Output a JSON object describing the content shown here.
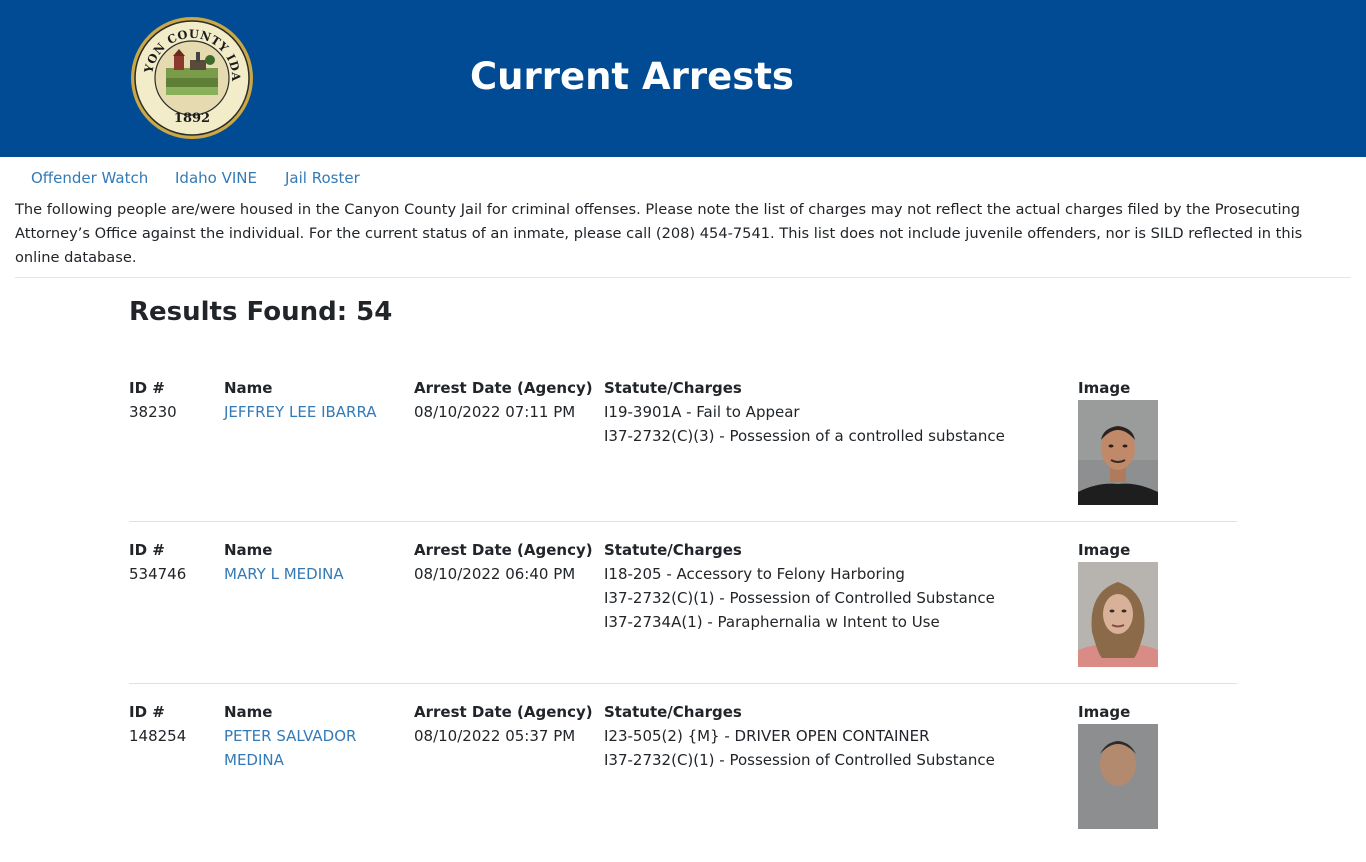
{
  "header": {
    "title": "Current Arrests",
    "seal_text": "CANYON COUNTY IDAHO",
    "seal_year": "1892",
    "background": "#004b93"
  },
  "nav": {
    "links": [
      {
        "label": "Offender Watch"
      },
      {
        "label": "Idaho VINE"
      },
      {
        "label": "Jail Roster"
      }
    ]
  },
  "intro": "The following people are/were housed in the Canyon County Jail for criminal offenses. Please note the list of charges may not reflect the actual charges filed by the Prosecuting Attorney’s Office against the individual. For the current status of an inmate, please call (208) 454-7541. This list does not include juvenile offenders, nor is SILD reflected in this online database.",
  "results": {
    "heading": "Results Found: 54"
  },
  "columns": {
    "id": "ID #",
    "name": "Name",
    "arrest_date": "Arrest Date (Agency)",
    "charges": "Statute/Charges",
    "image": "Image"
  },
  "records": [
    {
      "id": "38230",
      "name_line1": "JEFFREY LEE IBARRA",
      "name_line2": "",
      "arrest_date": "08/10/2022 07:11 PM",
      "charges": [
        "I19-3901A - Fail to Appear",
        "I37-2732(C)(3) - Possession of a controlled substance"
      ]
    },
    {
      "id": "534746",
      "name_line1": "MARY L MEDINA",
      "name_line2": "",
      "arrest_date": "08/10/2022 06:40 PM",
      "charges": [
        "I18-205 - Accessory to Felony Harboring",
        "I37-2732(C)(1) - Possession of Controlled Substance",
        "I37-2734A(1) - Paraphernalia w Intent to Use"
      ]
    },
    {
      "id": "148254",
      "name_line1": "PETER SALVADOR",
      "name_line2": "MEDINA",
      "arrest_date": "08/10/2022 05:37 PM",
      "charges": [
        "I23-505(2) {M} - DRIVER OPEN CONTAINER",
        "I37-2732(C)(1) - Possession of Controlled Substance"
      ]
    }
  ],
  "colors": {
    "link": "#337ab7",
    "text": "#212529"
  }
}
